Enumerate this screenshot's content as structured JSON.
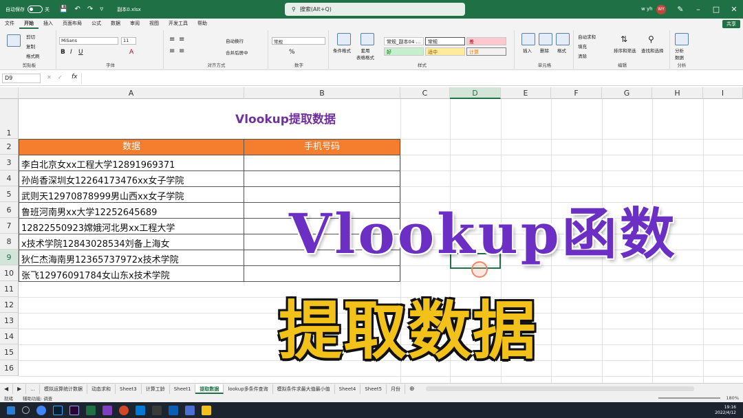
{
  "titlebar": {
    "autosave_label": "自动保存",
    "autosave_state": "关",
    "filename": "副本0.xlsx",
    "search_placeholder": "搜索(Alt+Q)",
    "user": "w yh",
    "user_initials": "WY"
  },
  "menu": {
    "tabs": [
      "文件",
      "开始",
      "插入",
      "页面布局",
      "公式",
      "数据",
      "审阅",
      "视图",
      "开发工具",
      "帮助"
    ],
    "active": "开始",
    "share": "共享"
  },
  "ribbon": {
    "clipboard": {
      "cut": "剪切",
      "copy": "复制",
      "painter": "格式刷",
      "label": "剪贴板"
    },
    "font": {
      "name": "MiSans",
      "size": "11",
      "label": "字体"
    },
    "alignment": {
      "wrap": "自动换行",
      "merge": "合并后居中",
      "label": "对齐方式"
    },
    "number": {
      "format": "常规",
      "label": "数字"
    },
    "styles": {
      "cond_format": "条件格式",
      "table_format": "套用\n表格格式",
      "cells": [
        "常规_副本04 ...",
        "常规",
        "差",
        "好",
        "适中",
        "计算"
      ],
      "label": "样式"
    },
    "cells_group": {
      "insert": "插入",
      "delete": "删除",
      "format": "格式",
      "label": "单元格"
    },
    "editing": {
      "autosum": "自动求和",
      "fill": "填充",
      "clear": "清除",
      "sort": "排序和筛选",
      "find": "查找和选择",
      "label": "编辑"
    },
    "analysis": {
      "analyze": "分析\n数据",
      "label": "分析"
    }
  },
  "formula_bar": {
    "name_box": "D9",
    "fx": "fx",
    "value": ""
  },
  "columns": [
    "A",
    "B",
    "C",
    "D",
    "E",
    "F",
    "G",
    "H",
    "I"
  ],
  "selected_column": "D",
  "rows": [
    "1",
    "2",
    "3",
    "4",
    "5",
    "6",
    "7",
    "8",
    "9",
    "10",
    "11",
    "12",
    "13",
    "14",
    "15",
    "16"
  ],
  "selected_row": "9",
  "sheet": {
    "title": "Vlookup提取数据",
    "header": [
      "数据",
      "手机号码"
    ],
    "data": [
      "李白北京女xx工程大学12891969371",
      "孙尚香深圳女12264173476xx女子学院",
      "武则天12970878999男山西xx女子学院",
      "鲁班河南男xx大学12252645689",
      "12822550923嫦娥河北男xx工程大学",
      "x技术学院12843028534刘备上海女",
      "狄仁杰海南男12365737972x技术学院",
      "张飞12976091784女山东x技术学院"
    ]
  },
  "overlay": {
    "line1": "Vlookup函数",
    "line2": "提取数据"
  },
  "sheet_tabs": [
    "...",
    "模拟运算统计数据",
    "动态求和",
    "Sheet3",
    "计算工龄",
    "Sheet1",
    "提取数据",
    "lookup多条件查询",
    "模拟条件求最大值最小值",
    "Sheet4",
    "Sheet5",
    "月份"
  ],
  "active_sheet": "提取数据",
  "status": {
    "ready": "就绪",
    "accessibility": "辅助功能: 调查",
    "zoom": "180%"
  },
  "taskbar": {
    "time": "19:16",
    "date": "2022/4/12"
  }
}
